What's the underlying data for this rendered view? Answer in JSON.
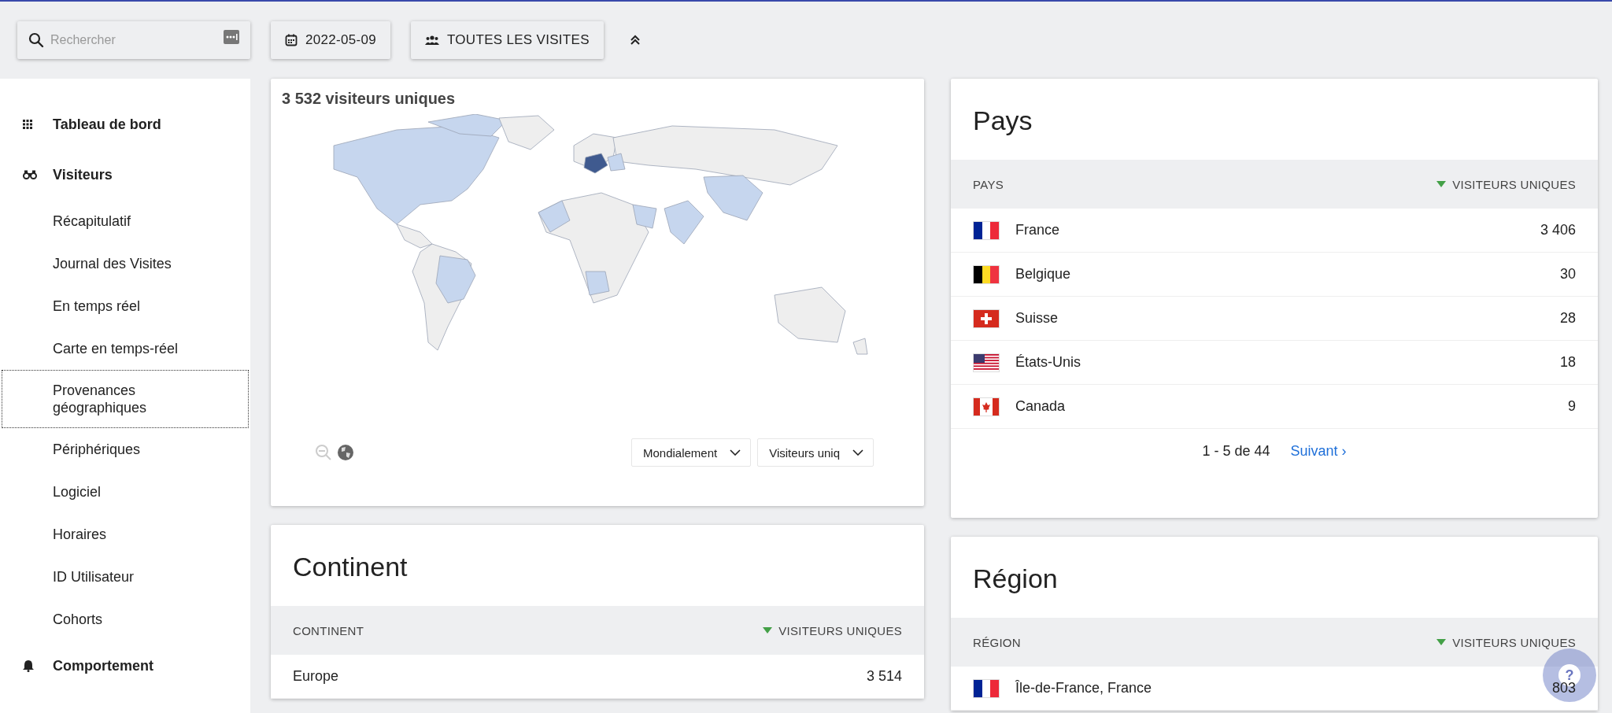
{
  "toolbar": {
    "search": {
      "placeholder": "Rechercher"
    },
    "date": "2022-05-09",
    "segment": "TOUTES LES VISITES"
  },
  "sidebar": {
    "items": [
      {
        "label": "Tableau de bord",
        "kind": "section",
        "selected": false
      },
      {
        "label": "Visiteurs",
        "kind": "section",
        "selected": false
      },
      {
        "label": "Récapitulatif",
        "kind": "sub",
        "selected": false
      },
      {
        "label": "Journal des Visites",
        "kind": "sub",
        "selected": false
      },
      {
        "label": "En temps réel",
        "kind": "sub",
        "selected": false
      },
      {
        "label": "Carte en temps-réel",
        "kind": "sub",
        "selected": false
      },
      {
        "label": "Provenances géographiques",
        "kind": "sub",
        "selected": true
      },
      {
        "label": "Périphériques",
        "kind": "sub",
        "selected": false
      },
      {
        "label": "Logiciel",
        "kind": "sub",
        "selected": false
      },
      {
        "label": "Horaires",
        "kind": "sub",
        "selected": false
      },
      {
        "label": "ID Utilisateur",
        "kind": "sub",
        "selected": false
      },
      {
        "label": "Cohorts",
        "kind": "sub",
        "selected": false
      },
      {
        "label": "Comportement",
        "kind": "section",
        "selected": false
      }
    ]
  },
  "map_card": {
    "title": "3 532 visiteurs uniques",
    "scope": "Mondialement",
    "metric": "Visiteurs uniq"
  },
  "continent_card": {
    "title": "Continent",
    "columns": [
      "CONTINENT",
      "VISITEURS UNIQUES"
    ],
    "rows": [
      {
        "label": "Europe",
        "value": "3 514"
      }
    ]
  },
  "country_card": {
    "title": "Pays",
    "columns": [
      "PAYS",
      "VISITEURS UNIQUES"
    ],
    "rows": [
      {
        "label": "France",
        "value": "3 406"
      },
      {
        "label": "Belgique",
        "value": "30"
      },
      {
        "label": "Suisse",
        "value": "28"
      },
      {
        "label": "États-Unis",
        "value": "18"
      },
      {
        "label": "Canada",
        "value": "9"
      }
    ],
    "pagination": "1 - 5 de 44",
    "next": "Suivant ›"
  },
  "region_card": {
    "title": "Région",
    "columns": [
      "RÉGION",
      "VISITEURS UNIQUES"
    ],
    "rows": [
      {
        "label": "Île-de-France, France",
        "value": "803"
      }
    ]
  },
  "help": "?"
}
